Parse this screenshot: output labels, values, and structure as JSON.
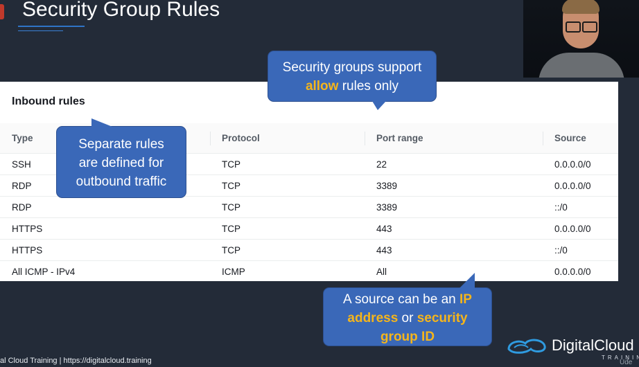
{
  "slide": {
    "title": "Security Group Rules"
  },
  "panel": {
    "title": "Inbound rules",
    "columns": [
      "Type",
      "Protocol",
      "Port range",
      "Source"
    ],
    "rows": [
      {
        "type": "SSH",
        "protocol": "TCP",
        "port": "22",
        "source": "0.0.0.0/0"
      },
      {
        "type": "RDP",
        "protocol": "TCP",
        "port": "3389",
        "source": "0.0.0.0/0"
      },
      {
        "type": "RDP",
        "protocol": "TCP",
        "port": "3389",
        "source": "::/0"
      },
      {
        "type": "HTTPS",
        "protocol": "TCP",
        "port": "443",
        "source": "0.0.0.0/0"
      },
      {
        "type": "HTTPS",
        "protocol": "TCP",
        "port": "443",
        "source": "::/0"
      },
      {
        "type": "All ICMP - IPv4",
        "protocol": "ICMP",
        "port": "All",
        "source": "0.0.0.0/0"
      }
    ]
  },
  "callouts": {
    "allow": {
      "pre": "Security groups support",
      "highlight": "allow",
      "post": "rules only"
    },
    "outbound": {
      "line1": "Separate rules",
      "line2": "are defined for",
      "line3": "outbound traffic"
    },
    "source": {
      "pre": "A source can be an",
      "hl1": "IP",
      "hl2": "address",
      "mid": "or",
      "hl3": "security",
      "hl4": "group ID"
    }
  },
  "brand": {
    "name": "DigitalCloud",
    "sub": "TRAINING",
    "udemy": "Ude"
  },
  "footer": {
    "text": "al Cloud Training  |  https://digitalcloud.training"
  },
  "colors": {
    "background": "#232b38",
    "callout": "#3a68b8",
    "highlight": "#f5b51b",
    "accent": "#2f74c7"
  },
  "icons": {
    "brand_logo": "digitalcloud-logo-icon",
    "slide_logo": "presenter-logo-icon"
  }
}
